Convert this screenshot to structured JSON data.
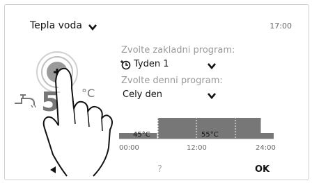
{
  "header": {
    "title": "Tepla voda",
    "time": "17:00"
  },
  "programs": {
    "base_label": "Zvolte zakladni program:",
    "base_value": "Tyden 1",
    "daily_label": "Zvolte denni program:",
    "daily_value": "Cely den"
  },
  "temperature": {
    "value": "5",
    "unit": "°C"
  },
  "chart_data": {
    "type": "area",
    "x": [
      "00:00",
      "12:00",
      "24:00"
    ],
    "segments": [
      {
        "from": "00:00",
        "to": "06:00",
        "temp": "45°C"
      },
      {
        "from": "06:00",
        "to": "22:00",
        "temp": "55°C"
      },
      {
        "from": "22:00",
        "to": "24:00",
        "temp": "45°C"
      }
    ],
    "labels": [
      "45°C",
      "55°C"
    ],
    "fill_color": "#777777"
  },
  "footer": {
    "help_label": "?",
    "ok_label": "OK"
  }
}
